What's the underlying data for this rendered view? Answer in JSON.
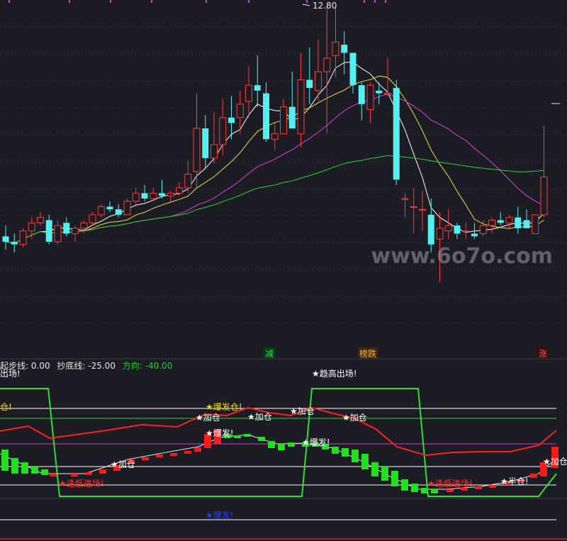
{
  "chart_data": [
    {
      "type": "candlestick",
      "price_high_label": "12.80",
      "markers": [
        {
          "text": "减",
          "color": "#20e040",
          "bg": "#0a3a12"
        },
        {
          "text": "榜跌",
          "color": "#ffb040",
          "bg": "#3a2a0a"
        },
        {
          "text": "涨",
          "color": "#ff5050",
          "bg": "#3a0a0a"
        }
      ],
      "candles": [
        [
          8.2,
          8.6,
          7.7,
          8.0
        ],
        [
          8.0,
          8.3,
          7.6,
          7.9
        ],
        [
          7.9,
          8.5,
          7.8,
          8.4
        ],
        [
          8.4,
          8.9,
          8.1,
          8.7
        ],
        [
          8.7,
          9.1,
          8.6,
          8.9
        ],
        [
          8.8,
          9.0,
          7.9,
          8.0
        ],
        [
          8.0,
          8.8,
          7.9,
          8.6
        ],
        [
          8.7,
          8.9,
          8.2,
          8.3
        ],
        [
          8.3,
          8.6,
          8.0,
          8.5
        ],
        [
          8.5,
          8.8,
          8.3,
          8.7
        ],
        [
          8.7,
          9.1,
          8.6,
          9.0
        ],
        [
          9.0,
          9.4,
          8.9,
          9.3
        ],
        [
          9.3,
          9.5,
          9.1,
          9.2
        ],
        [
          9.2,
          9.4,
          8.9,
          9.0
        ],
        [
          9.0,
          9.6,
          9.0,
          9.5
        ],
        [
          9.5,
          10.0,
          9.3,
          9.8
        ],
        [
          9.8,
          10.1,
          9.5,
          9.6
        ],
        [
          9.6,
          10.0,
          9.5,
          9.8
        ],
        [
          9.8,
          10.3,
          9.6,
          9.7
        ],
        [
          9.7,
          9.9,
          9.5,
          9.8
        ],
        [
          9.8,
          10.2,
          9.7,
          10.0
        ],
        [
          10.0,
          11.0,
          9.8,
          10.5
        ],
        [
          10.6,
          13.5,
          10.0,
          12.2
        ],
        [
          12.2,
          12.7,
          10.7,
          11.1
        ],
        [
          11.1,
          12.8,
          10.9,
          11.6
        ],
        [
          11.6,
          13.3,
          11.2,
          12.6
        ],
        [
          12.6,
          13.4,
          11.8,
          12.4
        ],
        [
          12.6,
          13.6,
          12.0,
          13.1
        ],
        [
          13.2,
          14.5,
          12.6,
          13.8
        ],
        [
          13.8,
          14.9,
          13.0,
          13.6
        ],
        [
          13.5,
          13.9,
          11.7,
          11.8
        ],
        [
          11.8,
          12.4,
          11.4,
          12.0
        ],
        [
          12.0,
          13.3,
          12.1,
          13.0
        ],
        [
          13.0,
          14.3,
          12.3,
          12.2
        ],
        [
          12.0,
          15.0,
          11.5,
          14.0
        ],
        [
          14.0,
          15.2,
          13.1,
          13.7
        ],
        [
          13.6,
          15.5,
          13.2,
          14.3
        ],
        [
          14.3,
          16.8,
          12.0,
          14.8
        ],
        [
          14.9,
          16.7,
          14.1,
          15.4
        ],
        [
          15.3,
          15.8,
          14.2,
          15.0
        ],
        [
          15.0,
          14.9,
          13.5,
          13.8
        ],
        [
          13.8,
          13.9,
          12.5,
          13.1
        ],
        [
          12.9,
          13.9,
          12.4,
          13.8
        ],
        [
          13.6,
          13.9,
          13.1,
          13.5
        ],
        [
          13.5,
          14.8,
          13.4,
          13.5
        ],
        [
          13.7,
          14.0,
          10.1,
          10.3
        ],
        [
          9.6,
          9.8,
          8.9,
          9.6
        ],
        [
          9.3,
          10.0,
          8.3,
          9.3
        ],
        [
          9.2,
          9.9,
          8.4,
          9.2
        ],
        [
          9.0,
          9.6,
          7.6,
          7.9
        ],
        [
          8.1,
          9.1,
          6.5,
          8.5
        ],
        [
          8.4,
          9.2,
          8.1,
          8.6
        ],
        [
          8.6,
          8.7,
          8.1,
          8.3
        ],
        [
          8.4,
          8.7,
          8.1,
          8.4
        ],
        [
          8.3,
          8.7,
          8.1,
          8.2
        ],
        [
          8.3,
          8.8,
          8.2,
          8.6
        ],
        [
          8.6,
          8.9,
          8.3,
          8.8
        ],
        [
          8.8,
          9.1,
          8.6,
          8.7
        ],
        [
          8.7,
          9.0,
          8.5,
          8.9
        ],
        [
          8.9,
          9.3,
          8.3,
          8.5
        ],
        [
          8.8,
          9.2,
          8.5,
          8.5
        ],
        [
          8.3,
          9.0,
          8.3,
          9.0
        ],
        [
          9.0,
          12.3,
          8.9,
          10.4
        ]
      ]
    },
    {
      "type": "indicator",
      "legend": [
        {
          "label": "起步线: 0.00",
          "color": "#e6e6e6"
        },
        {
          "label": "抄底线: -25.00",
          "color": "#e6e6e6"
        },
        {
          "label": "方向: -40.00",
          "color": "#20d020"
        }
      ],
      "top_partial_label": "★趋高出场!",
      "bottom_partial_label": "★爆发!",
      "left_partial_label": "仓!",
      "annotations": [
        {
          "text": "★加仓",
          "color": "#ffffff"
        },
        {
          "text": "★爆发仓!",
          "color": "#ffd700"
        },
        {
          "text": "★爆发!",
          "color": "#ffffff"
        },
        {
          "text": "★加仓",
          "color": "#ffffff"
        },
        {
          "text": "★加仓",
          "color": "#ffffff"
        },
        {
          "text": "★爆发!",
          "color": "#ffffff"
        },
        {
          "text": "★加仓",
          "color": "#ffffff"
        },
        {
          "text": "★加仓",
          "color": "#ffffff"
        },
        {
          "text": "★逢低进场!",
          "color": "#ff3030"
        },
        {
          "text": "★逢低进场!",
          "color": "#ff3030"
        },
        {
          "text": "★半仓!",
          "color": "#ffffff"
        },
        {
          "text": "★加仓",
          "color": "#ffffff"
        }
      ]
    }
  ],
  "watermark": "www.6o7o.com"
}
